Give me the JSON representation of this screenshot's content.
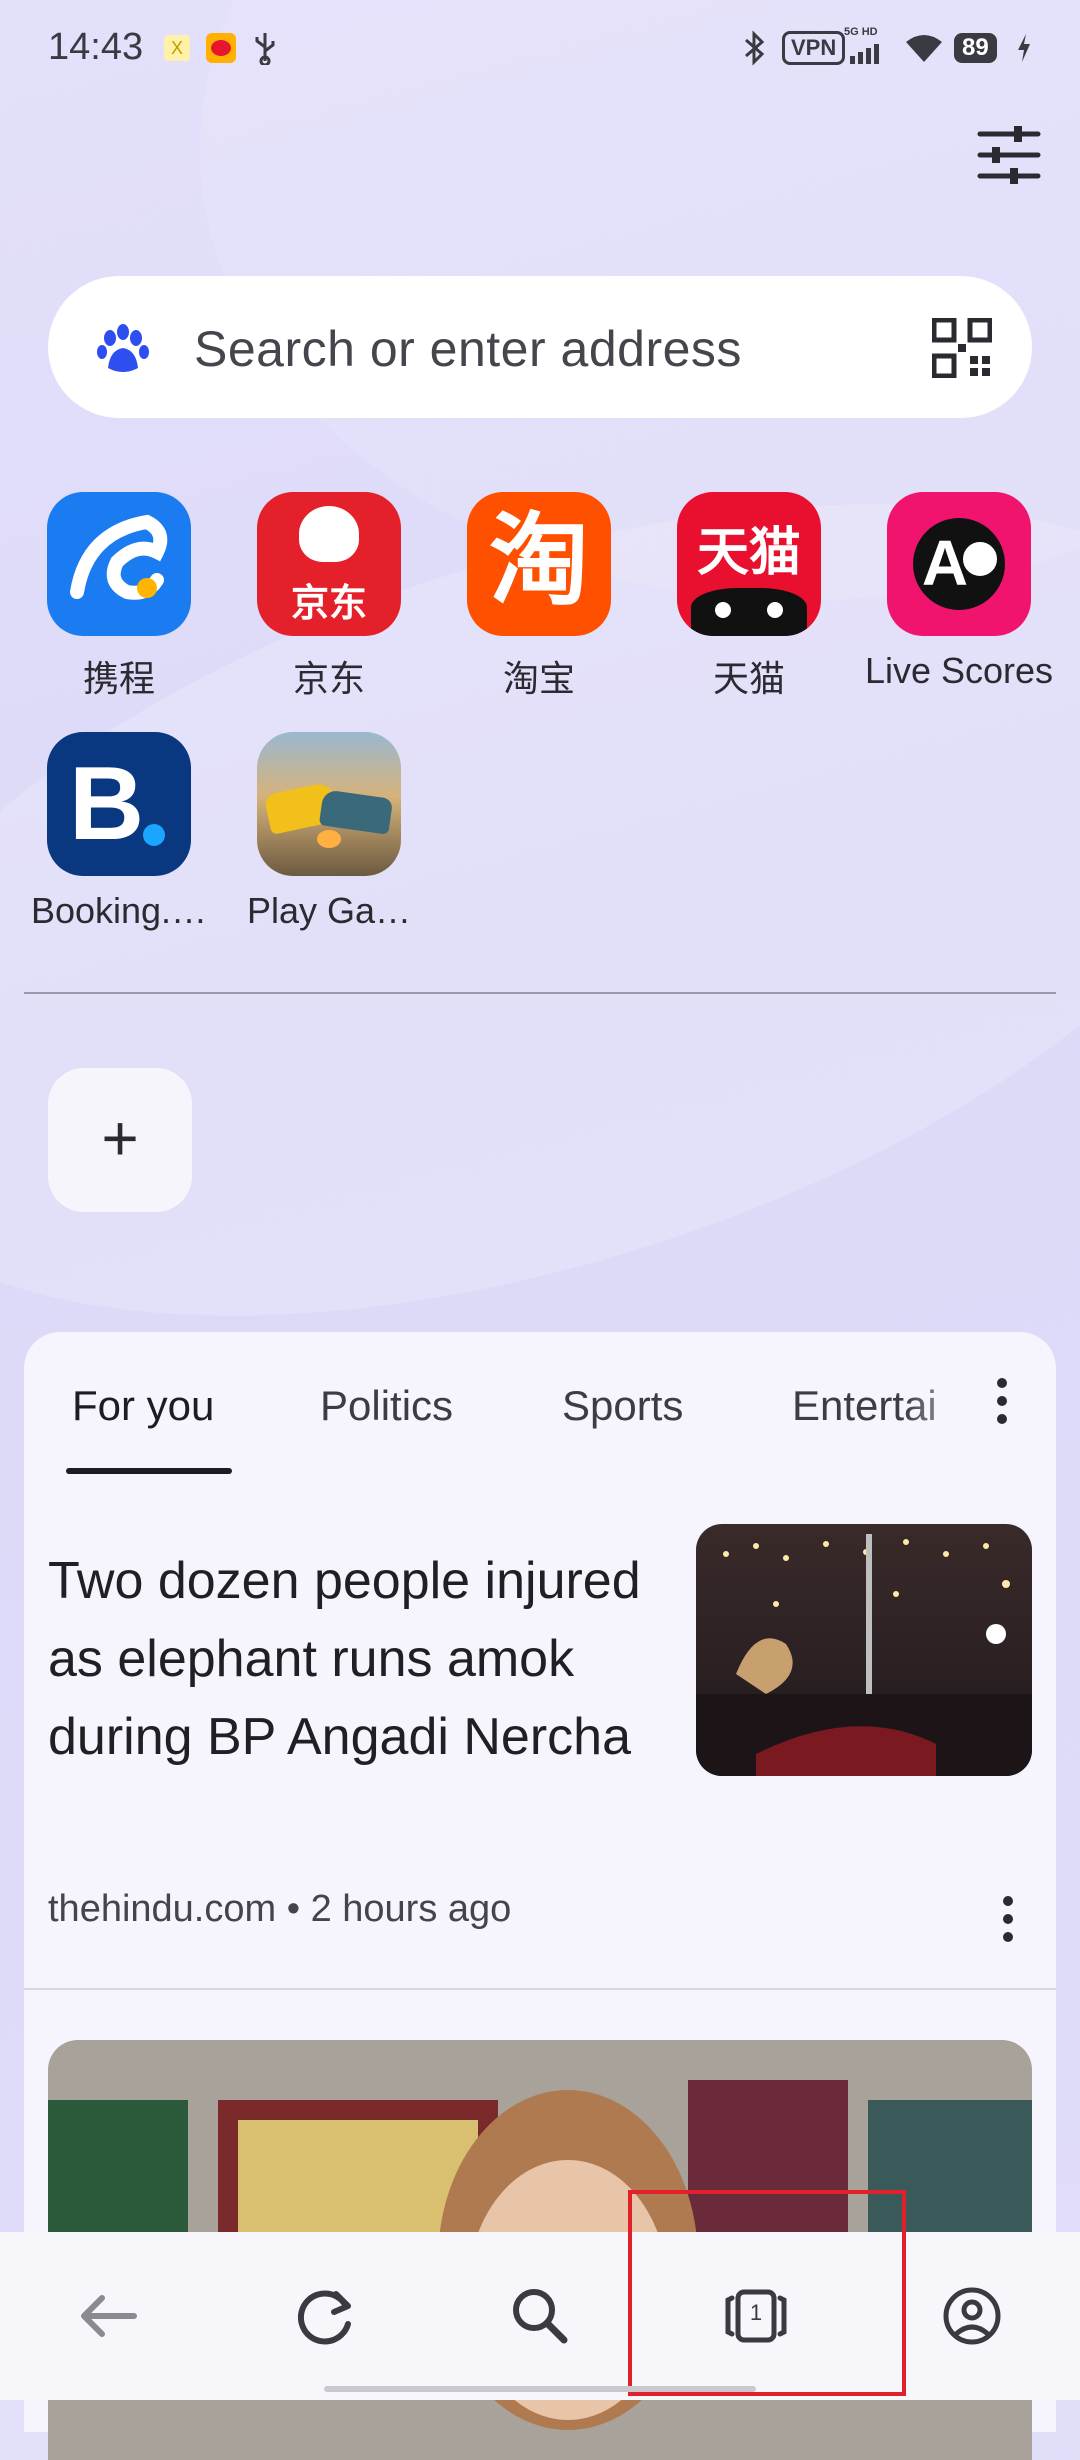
{
  "status_bar": {
    "time": "14:43",
    "vpn": "VPN",
    "network": "5G HD",
    "battery": "89"
  },
  "search": {
    "placeholder": "Search or enter address"
  },
  "shortcuts": [
    {
      "label": "携程",
      "color": "#1a7cf0"
    },
    {
      "label": "京东",
      "color": "#e4202a",
      "tile_text": "京东"
    },
    {
      "label": "淘宝",
      "color": "#ff5000",
      "tile_text": "淘"
    },
    {
      "label": "天猫",
      "color": "#e8102e",
      "tile_text": "天猫"
    },
    {
      "label": "Live Scores",
      "color": "#f0146e",
      "tile_text": "A"
    },
    {
      "label": "Booking.…",
      "color": "#0a3880",
      "tile_text": "B."
    },
    {
      "label": "Play Ga…",
      "color": "#7a8a60"
    }
  ],
  "feed": {
    "tabs": [
      "For you",
      "Politics",
      "Sports",
      "Entertai"
    ],
    "active_tab": "For you",
    "article": {
      "headline": "Two dozen people injured as elephant runs amok during BP Angadi Nercha",
      "source": "thehindu.com",
      "time": "2 hours ago"
    }
  },
  "bottom_nav": {
    "tab_count": "1"
  },
  "colors": {
    "accent": "#1a7cf0",
    "highlight": "#e0202a"
  }
}
